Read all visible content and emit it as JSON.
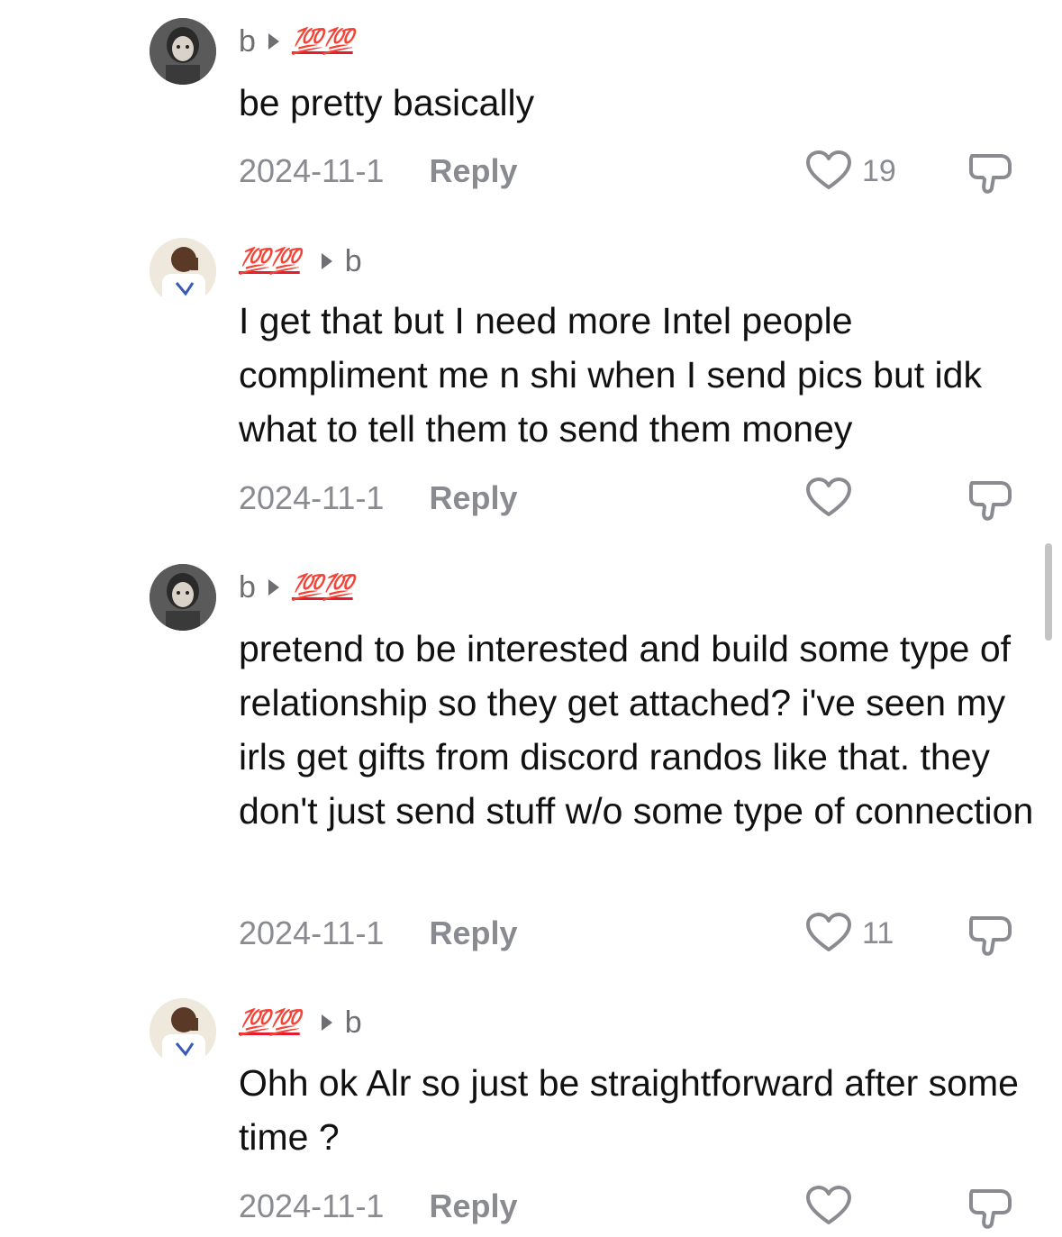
{
  "comments": [
    {
      "author": "b",
      "reply_to": "💯💯",
      "text": "be pretty basically",
      "date": "2024-11-1",
      "reply_label": "Reply",
      "likes": "19"
    },
    {
      "author": "💯💯",
      "reply_to": "b",
      "text": "I get that but I need more Intel people compliment me n shi when I send pics but idk what to tell them to send them money",
      "date": "2024-11-1",
      "reply_label": "Reply",
      "likes": ""
    },
    {
      "author": "b",
      "reply_to": "💯💯",
      "text": "pretend to be interested and build some type of relationship so they get attached? i've seen my irls get gifts from discord randos like that. they don't just send stuff w/o some type of connection",
      "date": "2024-11-1",
      "reply_label": "Reply",
      "likes": "11"
    },
    {
      "author": "💯💯",
      "reply_to": "b",
      "text": "Ohh ok Alr so just be straightforward after some time ?",
      "date": "2024-11-1",
      "reply_label": "Reply",
      "likes": ""
    }
  ],
  "icons": {
    "like": "heart-outline-icon",
    "dislike": "thumbs-down-outline-icon",
    "separator": "triangle-right-icon",
    "hundred": "hundred-points-emoji"
  },
  "colors": {
    "text": "#111111",
    "muted": "#8a8b91",
    "emoji_red": "#e21d2e"
  }
}
